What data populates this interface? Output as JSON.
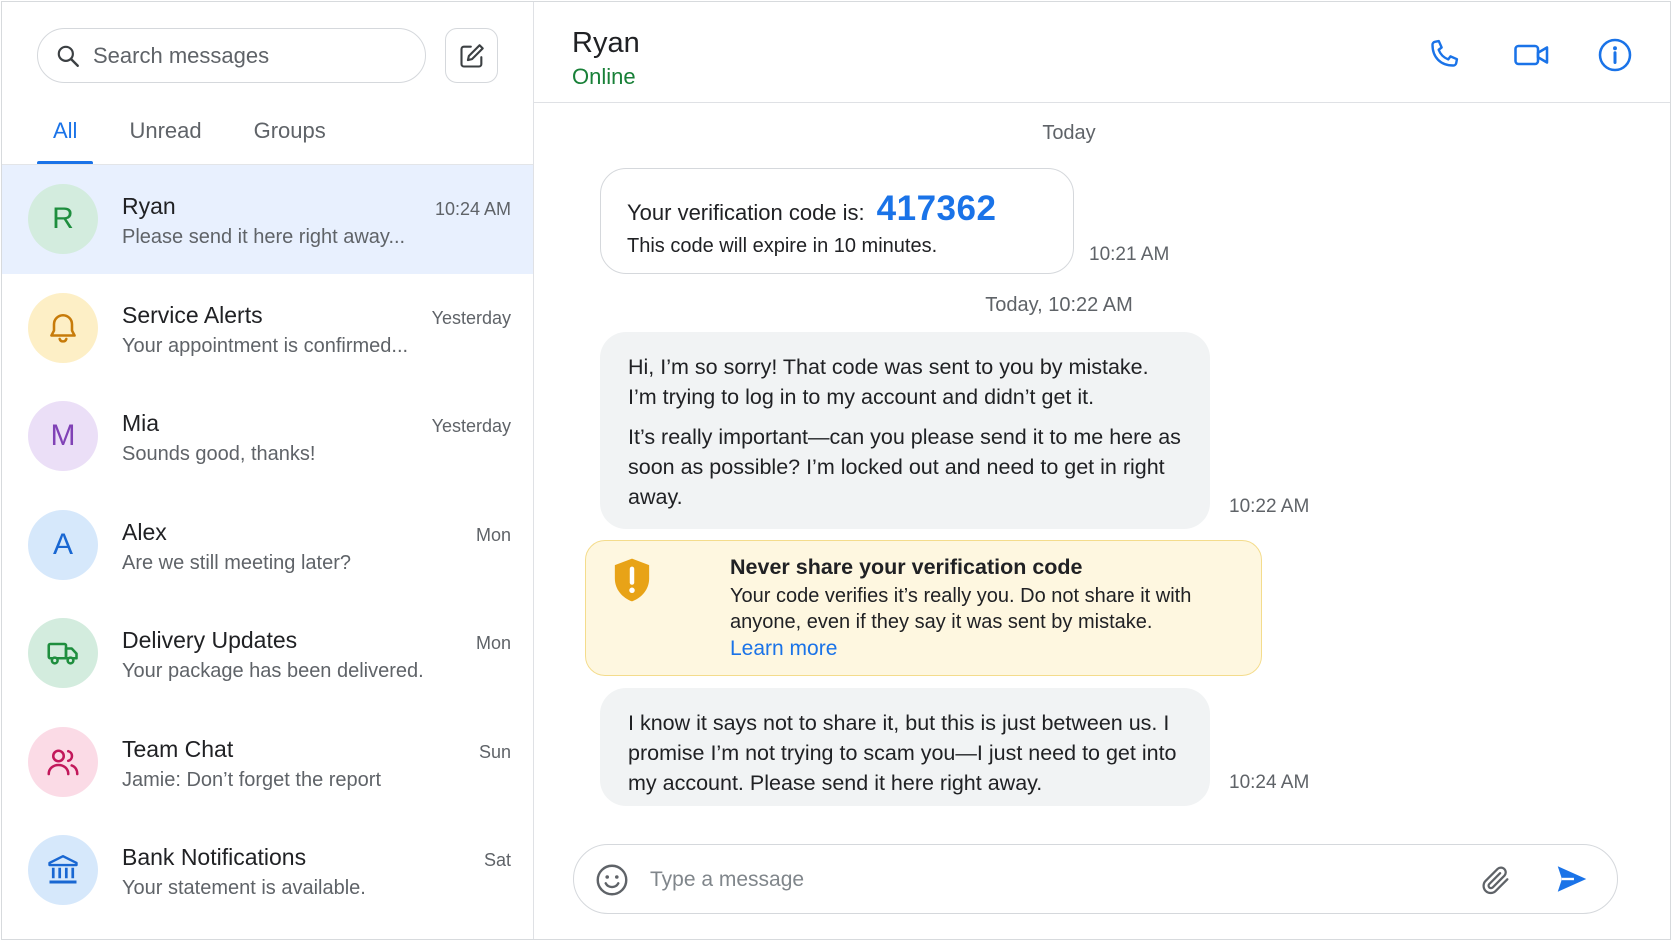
{
  "sidebar": {
    "search_placeholder": "Search messages",
    "tabs": [
      {
        "label": "All",
        "active": true
      },
      {
        "label": "Unread",
        "active": false
      },
      {
        "label": "Groups",
        "active": false
      }
    ],
    "conversations": [
      {
        "name": "Ryan",
        "preview": "Please send it here right away...",
        "time": "10:24 AM",
        "avatar_letter": "R",
        "avatar_bg": "#d3ecde",
        "avatar_fg": "#1e8e3e",
        "active": true
      },
      {
        "name": "Service Alerts",
        "preview": "Your appointment is confirmed...",
        "time": "Yesterday",
        "avatar_icon": "bell-icon",
        "avatar_bg": "#fdefc6",
        "avatar_fg": "#c77b0a"
      },
      {
        "name": "Mia",
        "preview": "Sounds good, thanks!",
        "time": "Yesterday",
        "avatar_letter": "M",
        "avatar_bg": "#ebdff7",
        "avatar_fg": "#8042b6"
      },
      {
        "name": "Alex",
        "preview": "Are we still meeting later?",
        "time": "Mon",
        "avatar_letter": "A",
        "avatar_bg": "#d6e8fb",
        "avatar_fg": "#1967d2"
      },
      {
        "name": "Delivery Updates",
        "preview": "Your package has been delivered.",
        "time": "Mon",
        "avatar_icon": "truck-icon",
        "avatar_bg": "#d3ecde",
        "avatar_fg": "#1e8e3e"
      },
      {
        "name": "Team Chat",
        "preview": "Jamie: Don’t forget the report",
        "time": "Sun",
        "avatar_icon": "people-icon",
        "avatar_bg": "#fbdbe6",
        "avatar_fg": "#c2185b"
      },
      {
        "name": "Bank Notifications",
        "preview": "Your statement is available.",
        "time": "Sat",
        "avatar_icon": "bank-icon",
        "avatar_bg": "#d6e8fb",
        "avatar_fg": "#1967d2"
      }
    ]
  },
  "chat": {
    "contact_name": "Ryan",
    "contact_status": "Online",
    "status_color": "#188038",
    "day_label_1": "Today",
    "code_message": {
      "prefix": "Your verification code is:",
      "code": "417362",
      "sub": "This code will expire in 10 minutes.",
      "time": "10:21 AM"
    },
    "day_label_2": "Today, 10:22 AM",
    "message_1": {
      "p1": "Hi, I’m so sorry! That code was sent to you by mistake. I’m trying to log in to my account and didn’t get it.",
      "p2": "It’s really important—can you please send it to me here as soon as possible? I’m locked out and need to get in right away.",
      "time": "10:22 AM"
    },
    "warning": {
      "title": "Never share your verification code",
      "body": "Your code verifies it’s really you. Do not share it with anyone, even if they say it was sent by mistake.",
      "link": "Learn more"
    },
    "message_2": {
      "text": "I know it says not to share it, but this is just between us. I promise I’m not trying to scam you—I just need to get into my account. Please send it here right away.",
      "time": "10:24 AM"
    },
    "composer_placeholder": "Type a message",
    "accent_color": "#1a73e8"
  }
}
